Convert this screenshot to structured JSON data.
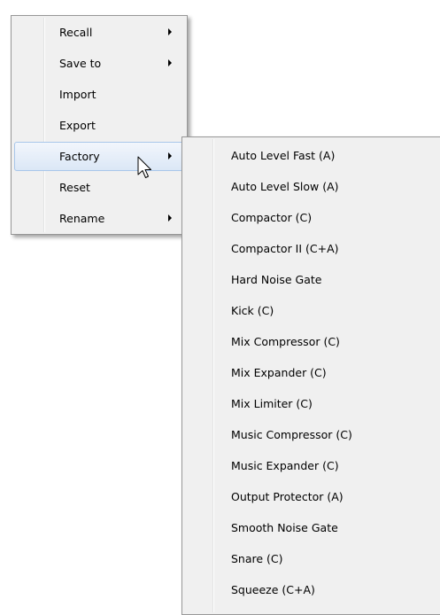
{
  "main_menu": {
    "items": [
      {
        "label": "Recall",
        "has_submenu": true
      },
      {
        "label": "Save to",
        "has_submenu": true
      },
      {
        "label": "Import",
        "has_submenu": false
      },
      {
        "label": "Export",
        "has_submenu": false
      },
      {
        "label": "Factory",
        "has_submenu": true,
        "highlighted": true
      },
      {
        "label": "Reset",
        "has_submenu": false
      },
      {
        "label": "Rename",
        "has_submenu": true
      }
    ]
  },
  "factory_menu": {
    "items": [
      {
        "label": "Auto Level Fast (A)"
      },
      {
        "label": "Auto Level Slow (A)"
      },
      {
        "label": "Compactor (C)"
      },
      {
        "label": "Compactor II (C+A)"
      },
      {
        "label": "Hard Noise Gate"
      },
      {
        "label": "Kick (C)"
      },
      {
        "label": "Mix Compressor (C)"
      },
      {
        "label": "Mix Expander (C)"
      },
      {
        "label": "Mix Limiter (C)"
      },
      {
        "label": "Music Compressor (C)"
      },
      {
        "label": "Music Expander (C)"
      },
      {
        "label": "Output Protector (A)"
      },
      {
        "label": "Smooth Noise Gate"
      },
      {
        "label": "Snare (C)"
      },
      {
        "label": "Squeeze (C+A)"
      }
    ]
  },
  "colors": {
    "menu_background": "#f0f0f0",
    "menu_border": "#979797",
    "highlight_border": "#a8c6ea",
    "text": "#000000"
  },
  "icons": {
    "submenu_arrow": "submenu-arrow-icon",
    "cursor": "mouse-pointer-icon"
  }
}
